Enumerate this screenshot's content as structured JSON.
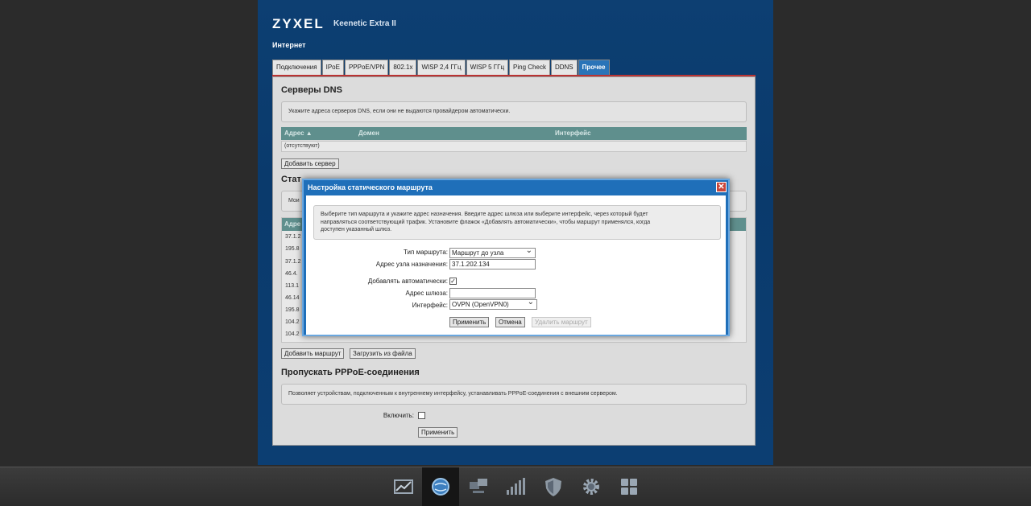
{
  "brand": "ZYXEL",
  "model": "Keenetic Extra II",
  "section": "Интернет",
  "tabs": [
    "Подключения",
    "IPoE",
    "PPPoE/VPN",
    "802.1x",
    "WISP 2,4 ГГц",
    "WISP 5 ГГц",
    "Ping Check",
    "DDNS",
    "Прочее"
  ],
  "active_tab": "Прочее",
  "dns": {
    "title": "Серверы DNS",
    "note": "Укажите адреса серверов DNS, если они не выдаются провайдером автоматически.",
    "columns": [
      "Адрес ▲",
      "Домен",
      "Интерфейс"
    ],
    "empty": "(отсутствуют)",
    "add_button": "Добавить сервер"
  },
  "static": {
    "title_partial": "Стат",
    "note_partial": "Мои",
    "header_partial": "Адре",
    "rows": [
      "37.1.2",
      "195.8",
      "37.1.2",
      "46.4.",
      "113.1",
      "46.14",
      "195.8",
      "104.2",
      "104.2"
    ],
    "add_button": "Добавить маршрут",
    "load_button": "Загрузить из файла"
  },
  "pppoe": {
    "title": "Пропускать PPPoE-соединения",
    "note": "Позволяет устройствам, подключенным к внутреннему интерфейсу, устанавливать PPPoE-соединения с внешним сервером.",
    "enable_label": "Включить:",
    "apply_button": "Применить"
  },
  "dialog": {
    "title": "Настройка статического маршрута",
    "close": "✕",
    "note_lines": [
      "Выберите тип маршрута и укажите адрес назначения. Введите адрес шлюза или выберите интерфейс, через который будет",
      "направляться соответствующий трафик. Установите флажок «Добавлять автоматически», чтобы маршрут применялся, когда",
      "доступен указанный шлюз."
    ],
    "route_type_label": "Тип маршрута:",
    "route_type_value": "Маршрут до узла",
    "dest_label": "Адрес узла назначения:",
    "dest_value": "37.1.202.134",
    "auto_label": "Добавлять автоматически:",
    "auto_checked": "✓",
    "gateway_label": "Адрес шлюза:",
    "gateway_value": "",
    "iface_label": "Интерфейс:",
    "iface_value": "OVPN (OpenVPN0)",
    "apply": "Применить",
    "cancel": "Отмена",
    "delete": "Удалить маршрут"
  },
  "taskbar_icons": [
    "chart-icon",
    "globe-icon",
    "network-icon",
    "signal-icon",
    "shield-icon",
    "gear-icon",
    "apps-icon"
  ]
}
